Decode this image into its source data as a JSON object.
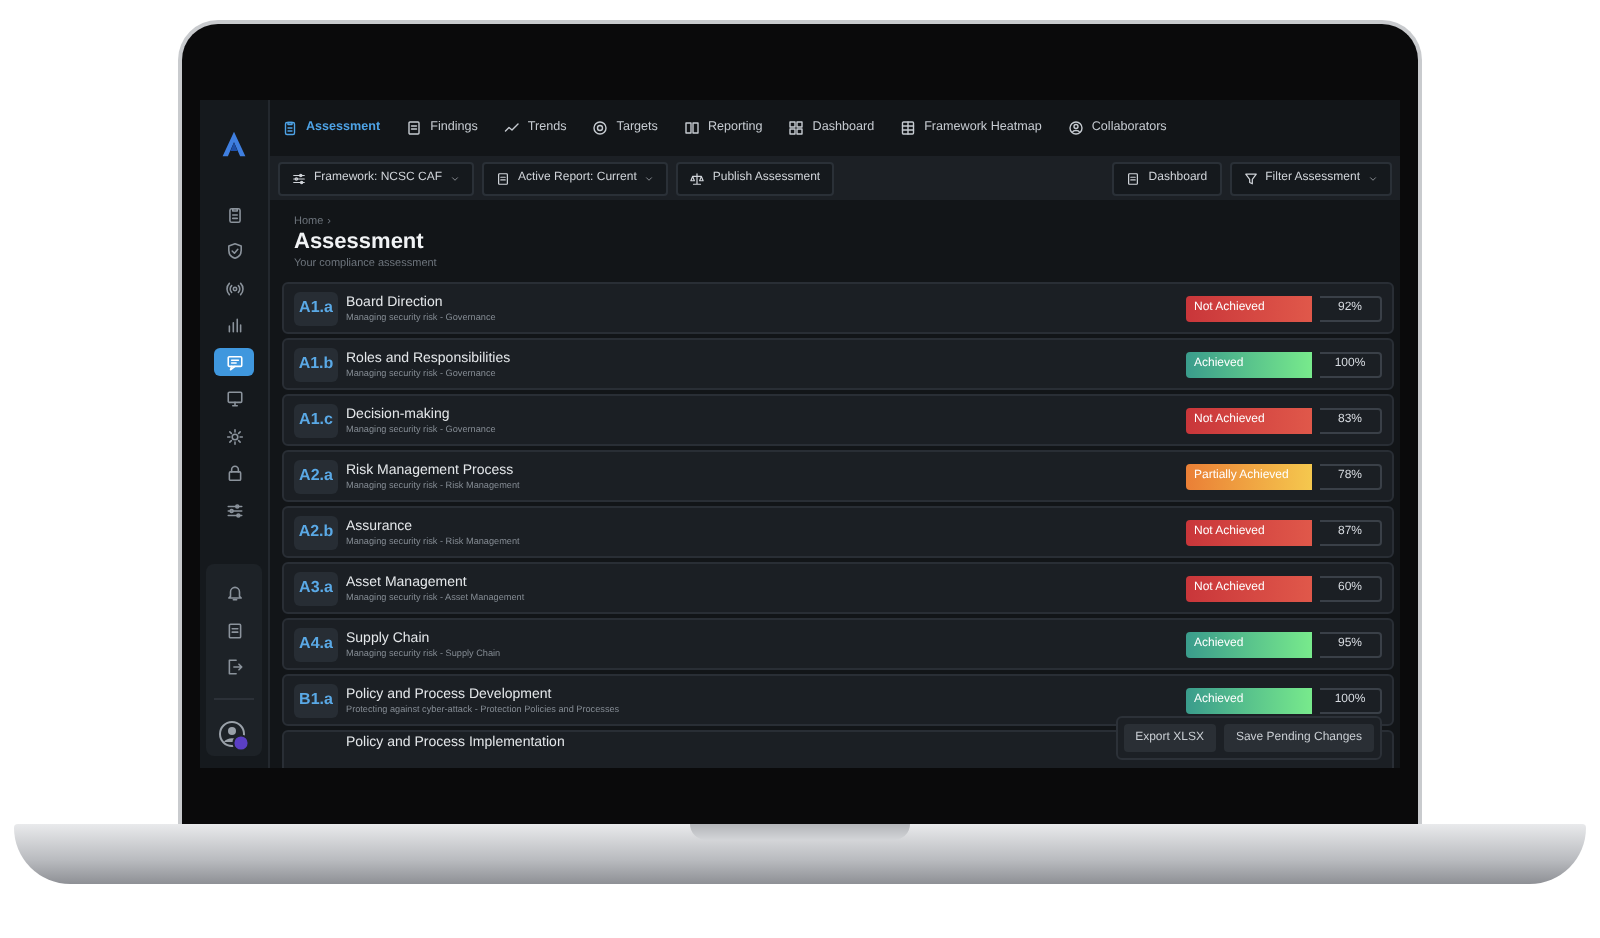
{
  "nav_tabs": [
    {
      "label": "Assessment",
      "selected": true
    },
    {
      "label": "Findings",
      "selected": false
    },
    {
      "label": "Trends",
      "selected": false
    },
    {
      "label": "Targets",
      "selected": false
    },
    {
      "label": "Reporting",
      "selected": false
    },
    {
      "label": "Dashboard",
      "selected": false
    },
    {
      "label": "Framework Heatmap",
      "selected": false
    },
    {
      "label": "Collaborators",
      "selected": false
    }
  ],
  "sidebar": {
    "items": [
      {
        "selected": false
      },
      {
        "selected": false
      },
      {
        "selected": false
      },
      {
        "selected": false
      },
      {
        "selected": true
      },
      {
        "selected": false
      },
      {
        "selected": false
      },
      {
        "selected": false
      },
      {
        "selected": false
      }
    ]
  },
  "toolbar": {
    "left": [
      {
        "label": "Framework: NCSC CAF",
        "dropdown": true
      },
      {
        "label": "Active Report: Current",
        "dropdown": true
      },
      {
        "label": "Publish Assessment",
        "dropdown": false
      }
    ],
    "right": [
      {
        "label": "Dashboard",
        "dropdown": false
      },
      {
        "label": "Filter Assessment",
        "dropdown": true
      }
    ]
  },
  "breadcrumb": {
    "home": "Home",
    "separator": "›"
  },
  "page": {
    "title": "Assessment",
    "subtitle": "Your compliance assessment"
  },
  "rows": [
    {
      "code": "A1.a",
      "title": "Board Direction",
      "subtitle": "Managing security risk - Governance",
      "status": "Not Achieved",
      "kind": "not_achieved",
      "score": "92%"
    },
    {
      "code": "A1.b",
      "title": "Roles and Responsibilities",
      "subtitle": "Managing security risk - Governance",
      "status": "Achieved",
      "kind": "achieved",
      "score": "100%"
    },
    {
      "code": "A1.c",
      "title": "Decision-making",
      "subtitle": "Managing security risk - Governance",
      "status": "Not Achieved",
      "kind": "not_achieved",
      "score": "83%"
    },
    {
      "code": "A2.a",
      "title": "Risk Management Process",
      "subtitle": "Managing security risk - Risk Management",
      "status": "Partially Achieved",
      "kind": "partial",
      "score": "78%"
    },
    {
      "code": "A2.b",
      "title": "Assurance",
      "subtitle": "Managing security risk - Risk Management",
      "status": "Not Achieved",
      "kind": "not_achieved",
      "score": "87%"
    },
    {
      "code": "A3.a",
      "title": "Asset Management",
      "subtitle": "Managing security risk - Asset Management",
      "status": "Not Achieved",
      "kind": "not_achieved",
      "score": "60%"
    },
    {
      "code": "A4.a",
      "title": "Supply Chain",
      "subtitle": "Managing security risk - Supply Chain",
      "status": "Achieved",
      "kind": "achieved",
      "score": "95%"
    },
    {
      "code": "B1.a",
      "title": "Policy and Process Development",
      "subtitle": "Protecting against cyber-attack - Protection Policies and Processes",
      "status": "Achieved",
      "kind": "achieved",
      "score": "100%"
    },
    {
      "title": "Policy and Process Implementation"
    }
  ],
  "actions": [
    "Export XLSX",
    "Save Pending Changes"
  ]
}
